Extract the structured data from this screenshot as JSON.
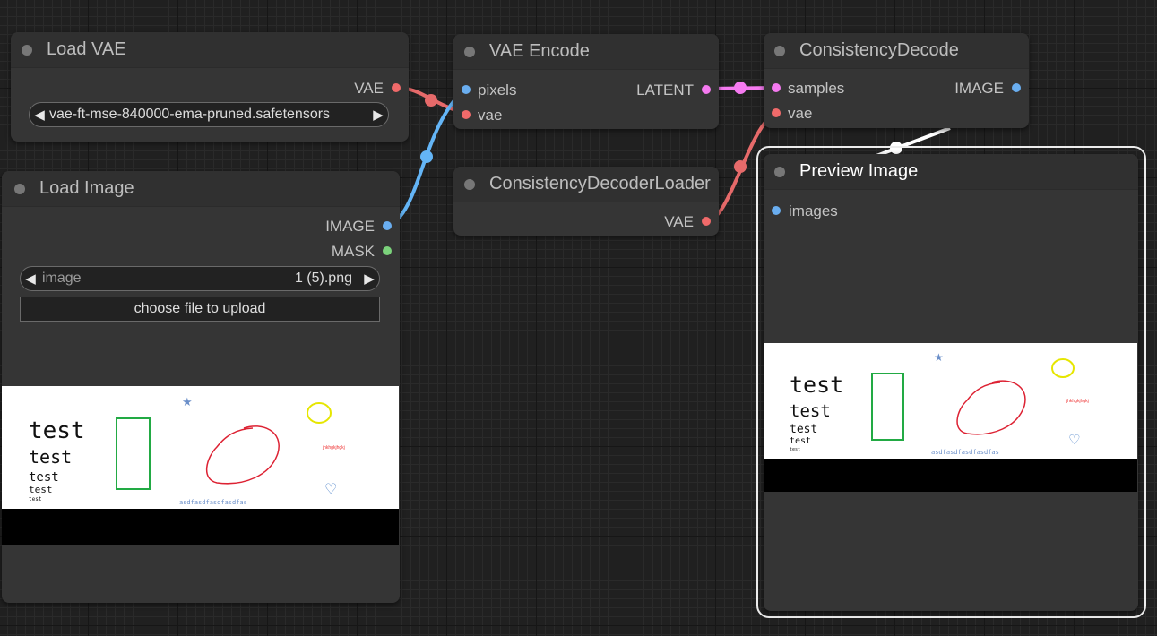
{
  "nodes": {
    "load_vae": {
      "title": "Load VAE",
      "output_vae": "VAE",
      "vae_name_value": "vae-ft-mse-840000-ema-pruned.safetensors"
    },
    "load_image": {
      "title": "Load Image",
      "output_image": "IMAGE",
      "output_mask": "MASK",
      "image_label": "image",
      "image_value": "1 (5).png",
      "upload_label": "choose file to upload"
    },
    "vae_encode": {
      "title": "VAE Encode",
      "input_pixels": "pixels",
      "input_vae": "vae",
      "output_latent": "LATENT"
    },
    "consistency_decoder_loader": {
      "title": "ConsistencyDecoderLoader",
      "output_vae": "VAE"
    },
    "consistency_decode": {
      "title": "ConsistencyDecode",
      "input_samples": "samples",
      "input_vae": "vae",
      "output_image": "IMAGE"
    },
    "preview_image": {
      "title": "Preview Image",
      "input_images": "images"
    }
  },
  "image_content": {
    "texts": [
      "test",
      "test",
      "test",
      "test",
      "test"
    ],
    "small_red_text": "jhkhgkjhgkj",
    "caption": "asdfasdfasdfasdfas"
  },
  "colors": {
    "vae_link": "#e66a6a",
    "image_link": "#64b5f6",
    "latent_link": "#f57af0",
    "output_link": "#ffffff"
  }
}
